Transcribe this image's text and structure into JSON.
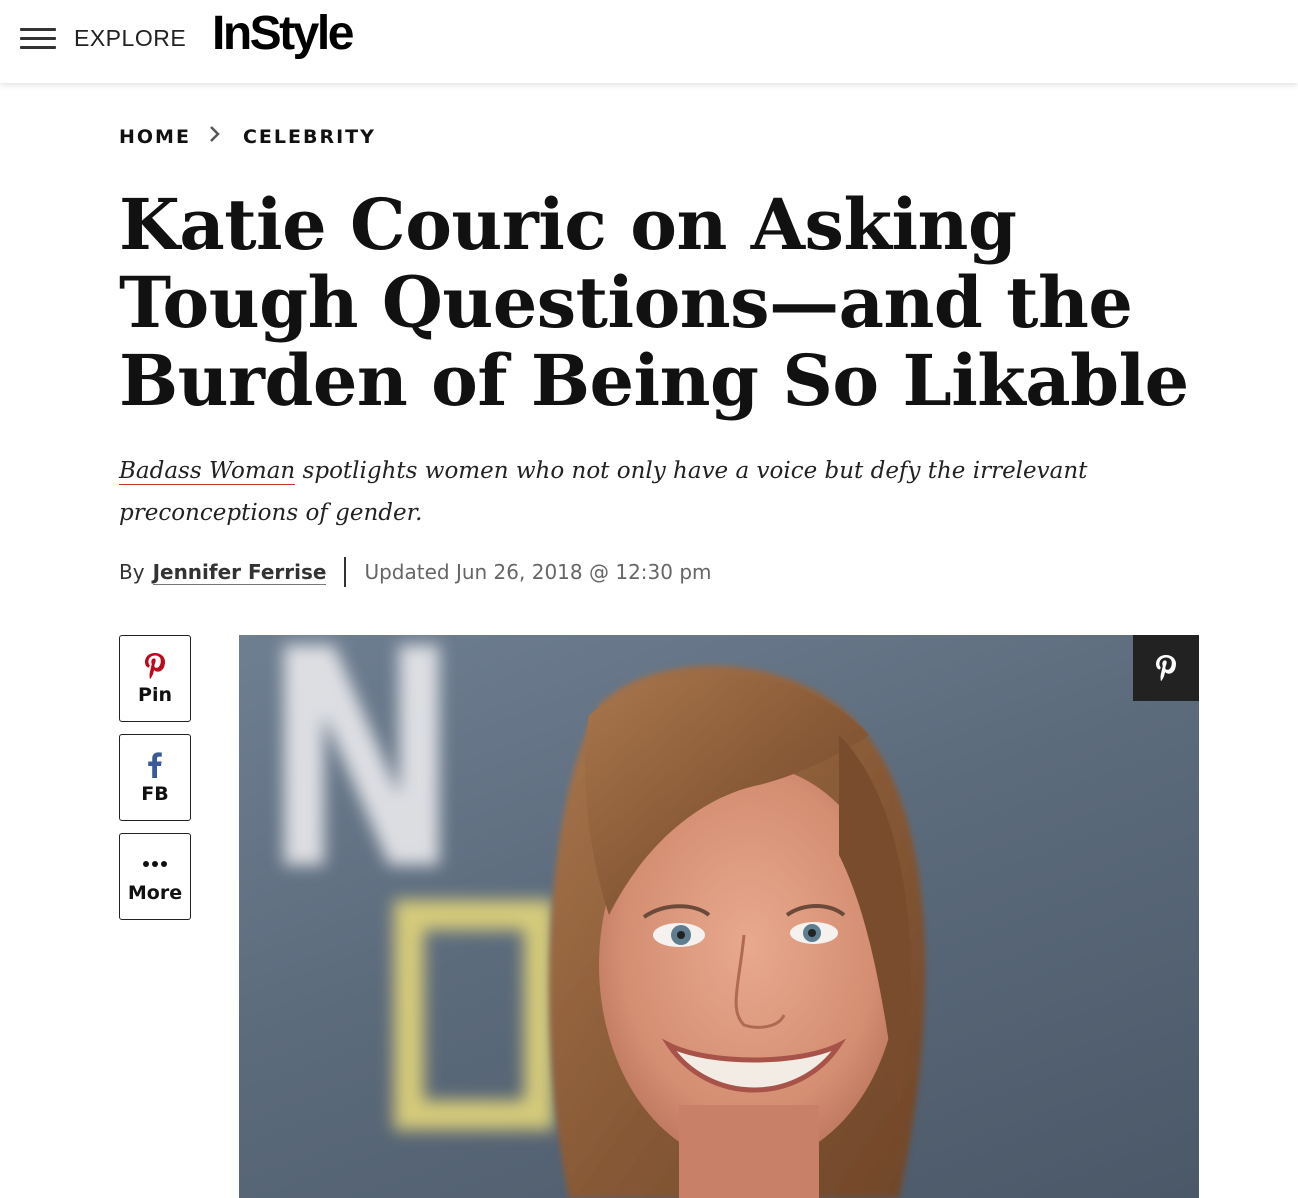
{
  "header": {
    "explore_label": "EXPLORE",
    "logo_text": "InStyle"
  },
  "breadcrumb": {
    "items": [
      "HOME",
      "CELEBRITY"
    ]
  },
  "article": {
    "title": "Katie Couric on Asking Tough Questions—and the Burden of Being So Likable",
    "dek_link": "Badass Woman",
    "dek_rest": " spotlights women who not only have a voice but defy the irrelevant preconceptions of gender.",
    "byline_prefix": "By",
    "author": "Jennifer Ferrise",
    "updated": "Updated Jun 26, 2018 @ 12:30 pm"
  },
  "share": {
    "pin_label": "Pin",
    "fb_label": "FB",
    "more_label": "More"
  },
  "colors": {
    "pinterest": "#bd081c",
    "facebook": "#3b5998",
    "dek_underline": "#c0392b"
  }
}
